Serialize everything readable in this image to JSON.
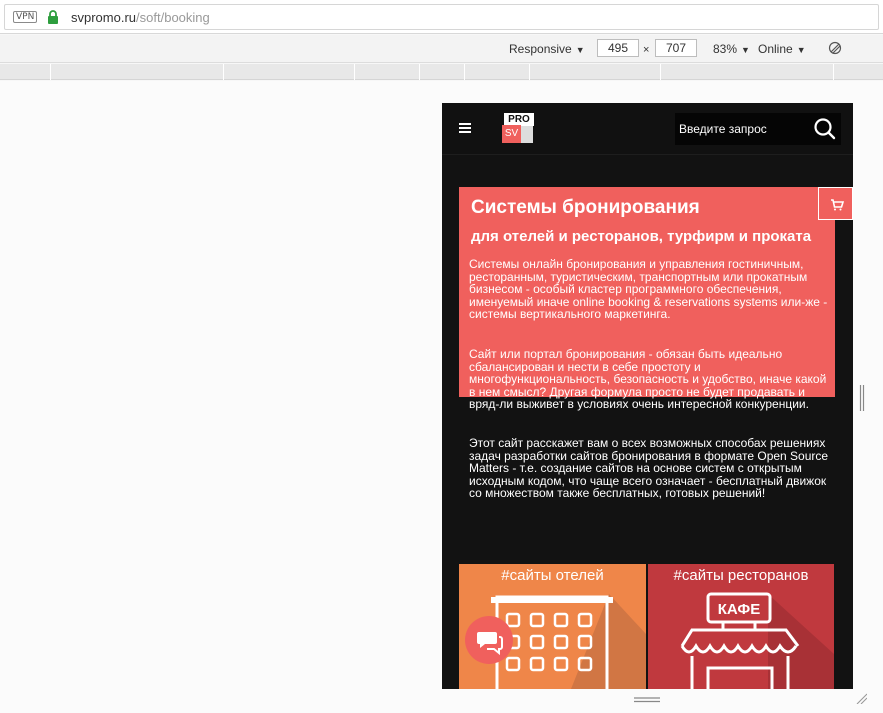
{
  "browser": {
    "vpn_label": "VPN",
    "url_domain": "svpromo.ru",
    "url_path": "/soft/booking"
  },
  "devtools": {
    "device_mode": "Responsive",
    "width": "495",
    "times": "×",
    "height": "707",
    "zoom": "83%",
    "network": "Online"
  },
  "site": {
    "logo_top": "PRO",
    "logo_bottom": "SV",
    "search_placeholder": "Введите запрос",
    "hero_title": "Системы бронирования",
    "hero_subtitle": "для отелей и ресторанов, турфирм и проката",
    "paragraph_1": "Системы онлайн бронирования и управления гостиничным, ресторанным, туристическим, транспортным или прокатным бизнесом - особый кластер программного обеспечения, именуемый иначе online booking & reservations systems или-же - системы вертикального маркетинга.",
    "paragraph_2": "Сайт или портал бронирования - обязан быть идеально сбалансирован и нести в себе простоту и многофункциональность, безопасность и удобство, иначе какой в нем смысл? Другая формула просто не будет продавать и вряд-ли выживет в условиях очень интересной конкуренции.",
    "paragraph_3": "Этот сайт расскажет вам о всех возможных способах решениях задач разработки сайтов бронирования в формате Open Source Matters - т.е. создание сайтов на основе систем с открытым исходным кодом, что чаще всего означает - бесплатный движок со множеством также бесплатных, готовых решений!",
    "tiles": [
      {
        "label": "#сайты отелей",
        "color": "#ef8649"
      },
      {
        "label": "#сайты ресторанов",
        "color": "#c0393e",
        "sign": "КАФЕ"
      }
    ]
  },
  "colors": {
    "accent": "#f0605d",
    "site_background": "#121212",
    "lock_green": "#2e9e3e"
  }
}
